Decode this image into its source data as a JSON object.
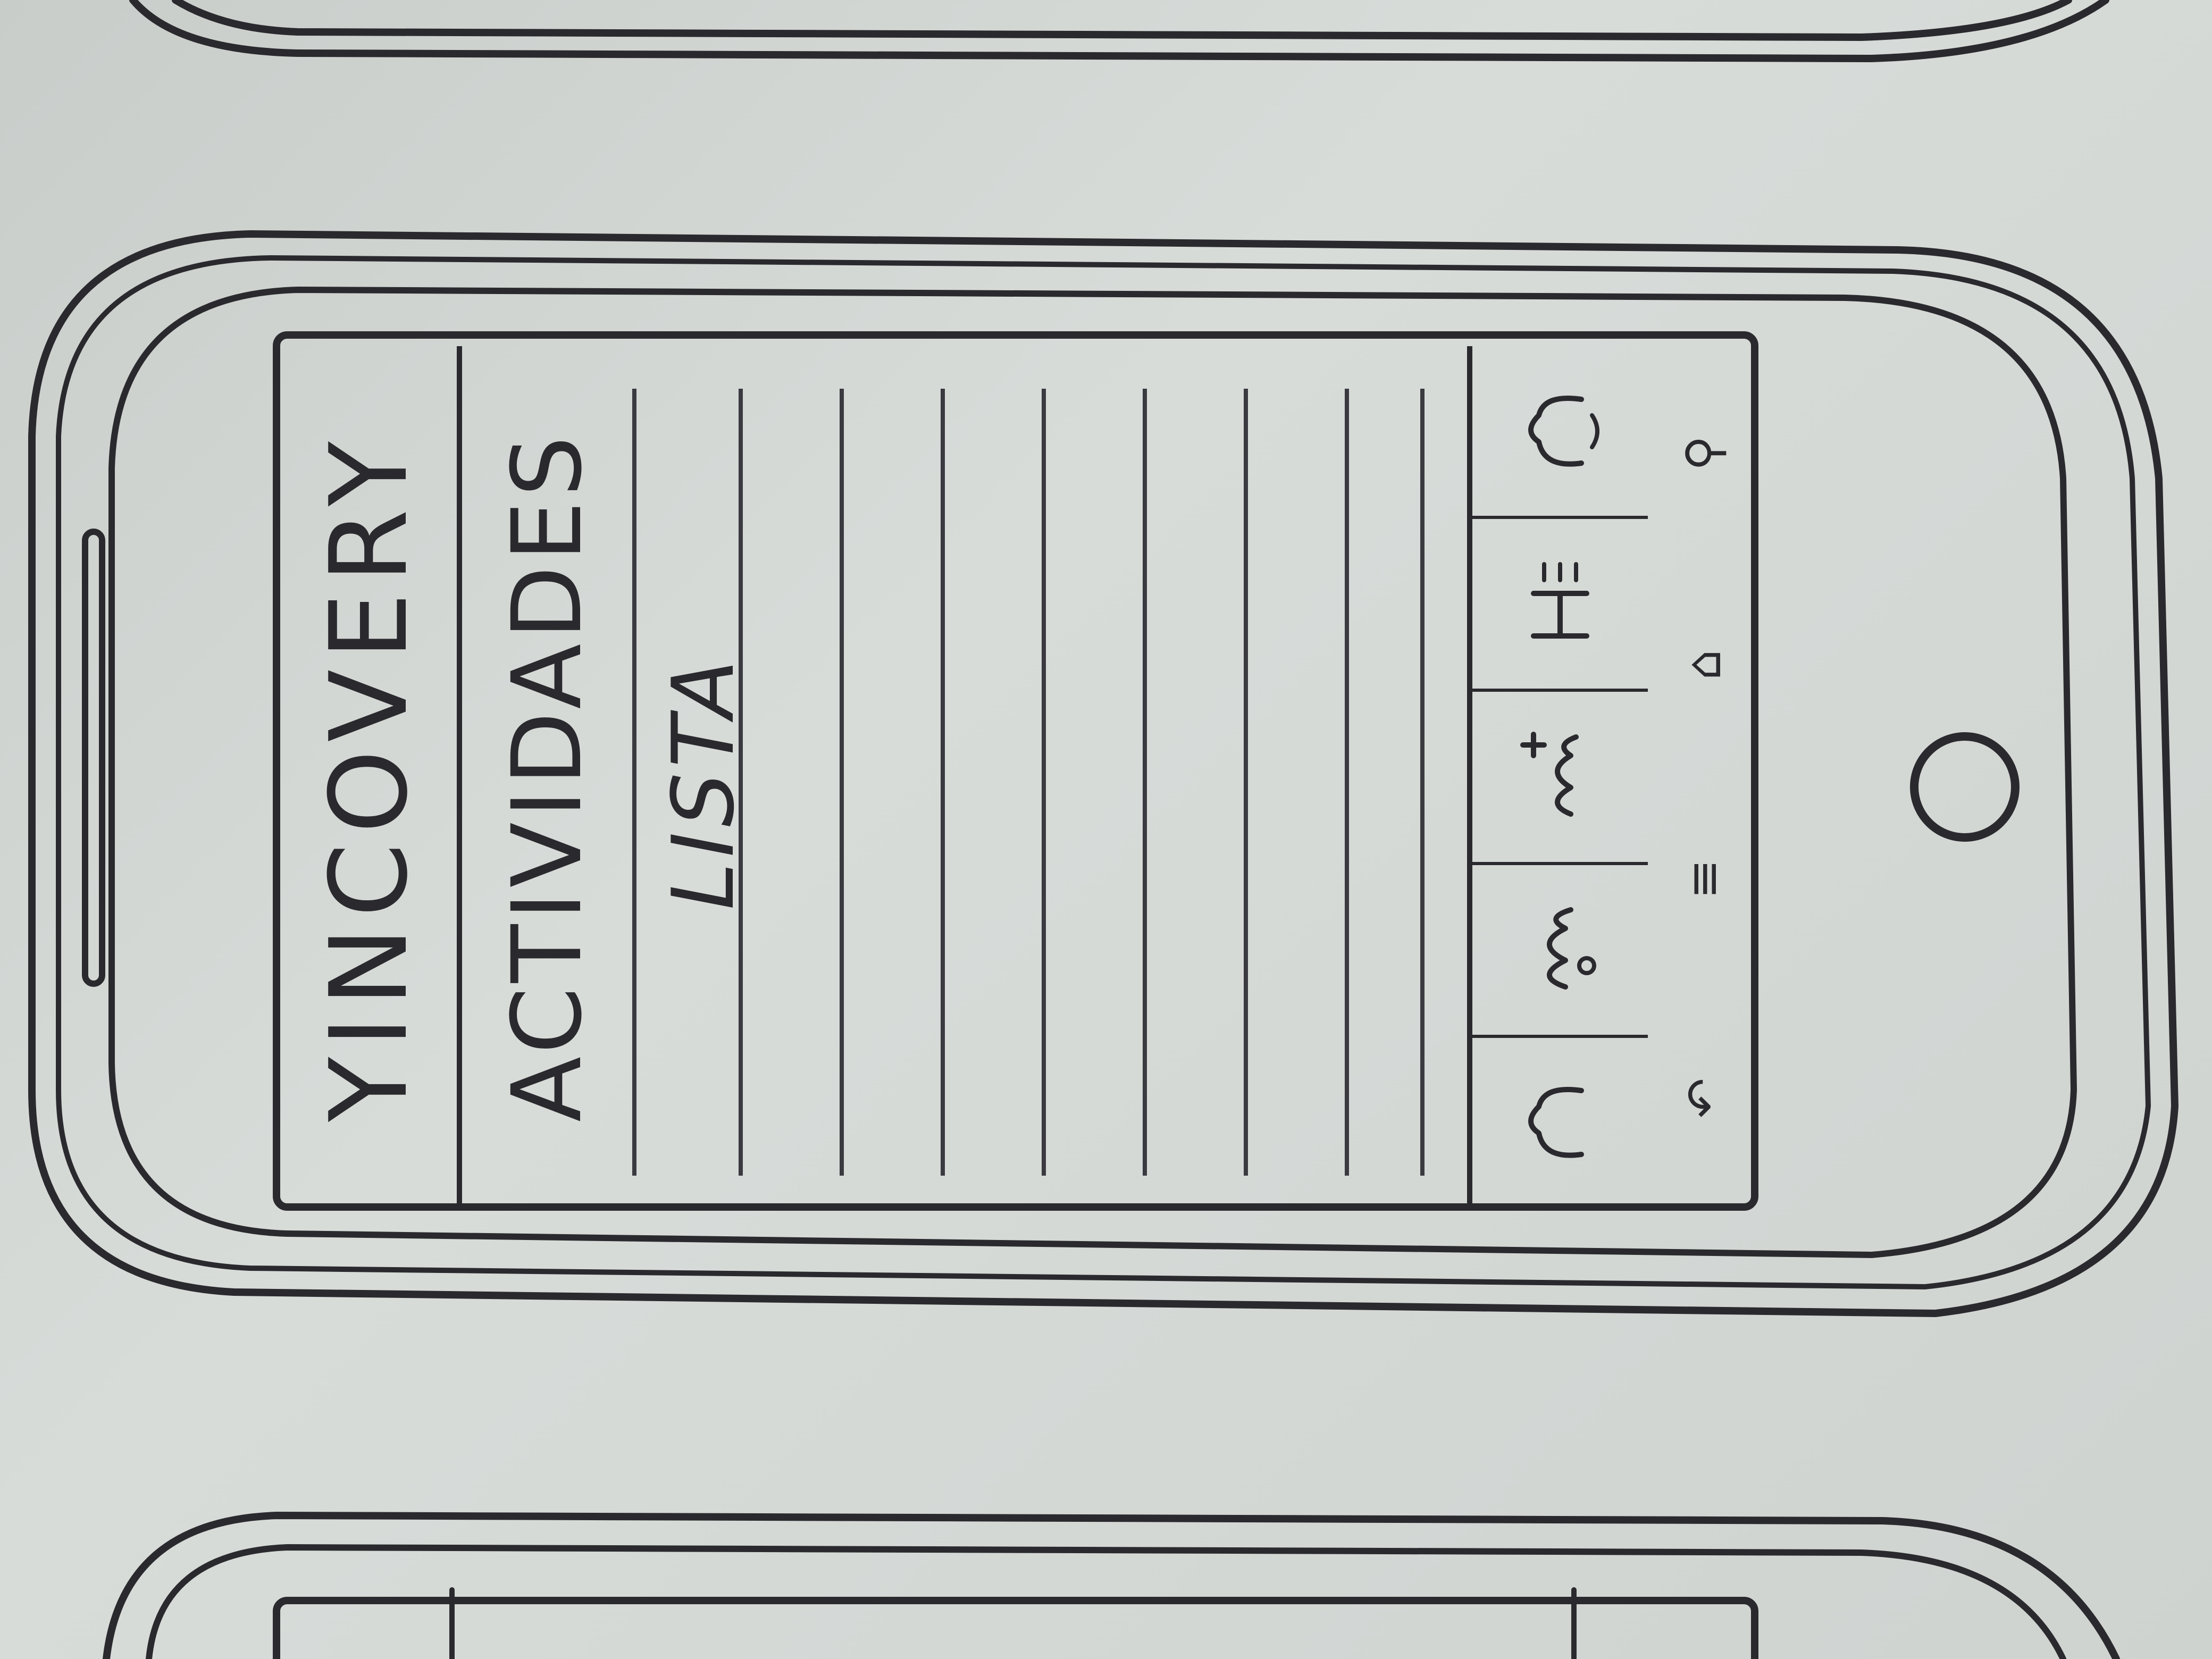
{
  "app": {
    "title": "YINCOVERY",
    "section_title": "ACTIVIDADES"
  },
  "list": {
    "label": "LISTA",
    "rows": [
      "",
      "",
      "",
      "",
      "",
      "",
      ""
    ]
  },
  "tabbar": {
    "tabs": [
      {
        "icon": "sketch-icon"
      },
      {
        "icon": "sketch-icon"
      },
      {
        "icon": "add-sketch-icon"
      },
      {
        "icon": "sketch-icon"
      },
      {
        "icon": "sketch-icon"
      }
    ]
  },
  "navbar": {
    "buttons": [
      {
        "icon": "back-icon",
        "glyph": "↶"
      },
      {
        "icon": "menu-icon",
        "glyph": "≡"
      },
      {
        "icon": "home-icon",
        "glyph": "⌂"
      },
      {
        "icon": "search-icon",
        "glyph": "⚲"
      }
    ]
  }
}
